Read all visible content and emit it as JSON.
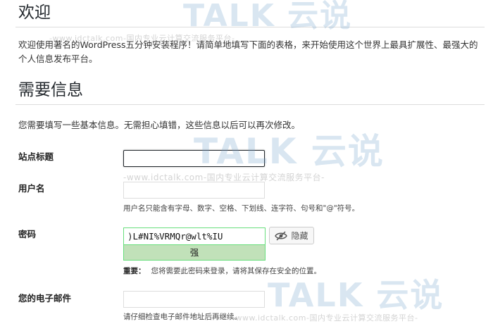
{
  "headings": {
    "welcome": "欢迎",
    "info_needed": "需要信息"
  },
  "intro_text": "欢迎使用著名的WordPress五分钟安装程序！请简单地填写下面的表格，来开始使用这个世界上最具扩展性、最强大的个人信息发布平台。",
  "info_note": "您需要填写一些基本信息。无需担心填错，这些信息以后可以再次修改。",
  "fields": {
    "site_title": {
      "label": "站点标题",
      "value": ""
    },
    "username": {
      "label": "用户名",
      "value": "",
      "hint": "用户名只能含有字母、数字、空格、下划线、连字符、句号和\"@\"符号。"
    },
    "password": {
      "label": "密码",
      "value": ")L#NI%VRMQr@wlt%IU",
      "strength": "强",
      "hide_label": "隐藏",
      "important_label": "重要：",
      "important_text": "您将需要此密码来登录，请将其保存在安全的位置。"
    },
    "email": {
      "label": "您的电子邮件",
      "value": "",
      "hint": "请仔细检查电子邮件地址后再继续。"
    }
  },
  "watermarks": {
    "logo_text": "TALK 云说",
    "url_text": "-www.idctalk.com-国内专业云计算交流服务平台-"
  },
  "colors": {
    "strength_bg": "#c1e1b9",
    "strength_border": "#68de7c",
    "focus_border": "#23282d"
  },
  "icons": {
    "hide_toggle": "eye-slash-icon"
  }
}
